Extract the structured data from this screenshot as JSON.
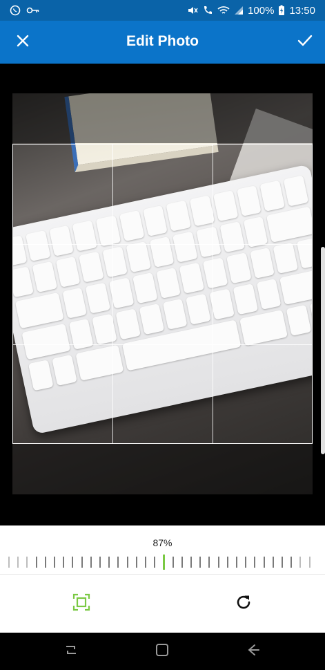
{
  "status_bar": {
    "battery_percent": "100%",
    "time": "13:50",
    "icons": [
      "whatsapp-icon",
      "key-icon",
      "mute-icon",
      "wifi-call-icon",
      "wifi-icon",
      "signal-icon",
      "battery-charging-icon"
    ]
  },
  "app_bar": {
    "title": "Edit Photo",
    "close_icon": "close-icon",
    "confirm_icon": "check-icon"
  },
  "editor": {
    "zoom_percent": "87%",
    "zoom_value": 0.87,
    "tools": [
      {
        "name": "crop",
        "icon": "crop-icon",
        "color": "#7ac943"
      },
      {
        "name": "rotate",
        "icon": "rotate-icon"
      }
    ]
  },
  "colors": {
    "status_bar": "#0a63a8",
    "app_bar": "#0b74c9",
    "accent": "#7ac943"
  },
  "nav_bar": {
    "icons": [
      "recent-apps-icon",
      "home-icon",
      "back-icon"
    ]
  }
}
